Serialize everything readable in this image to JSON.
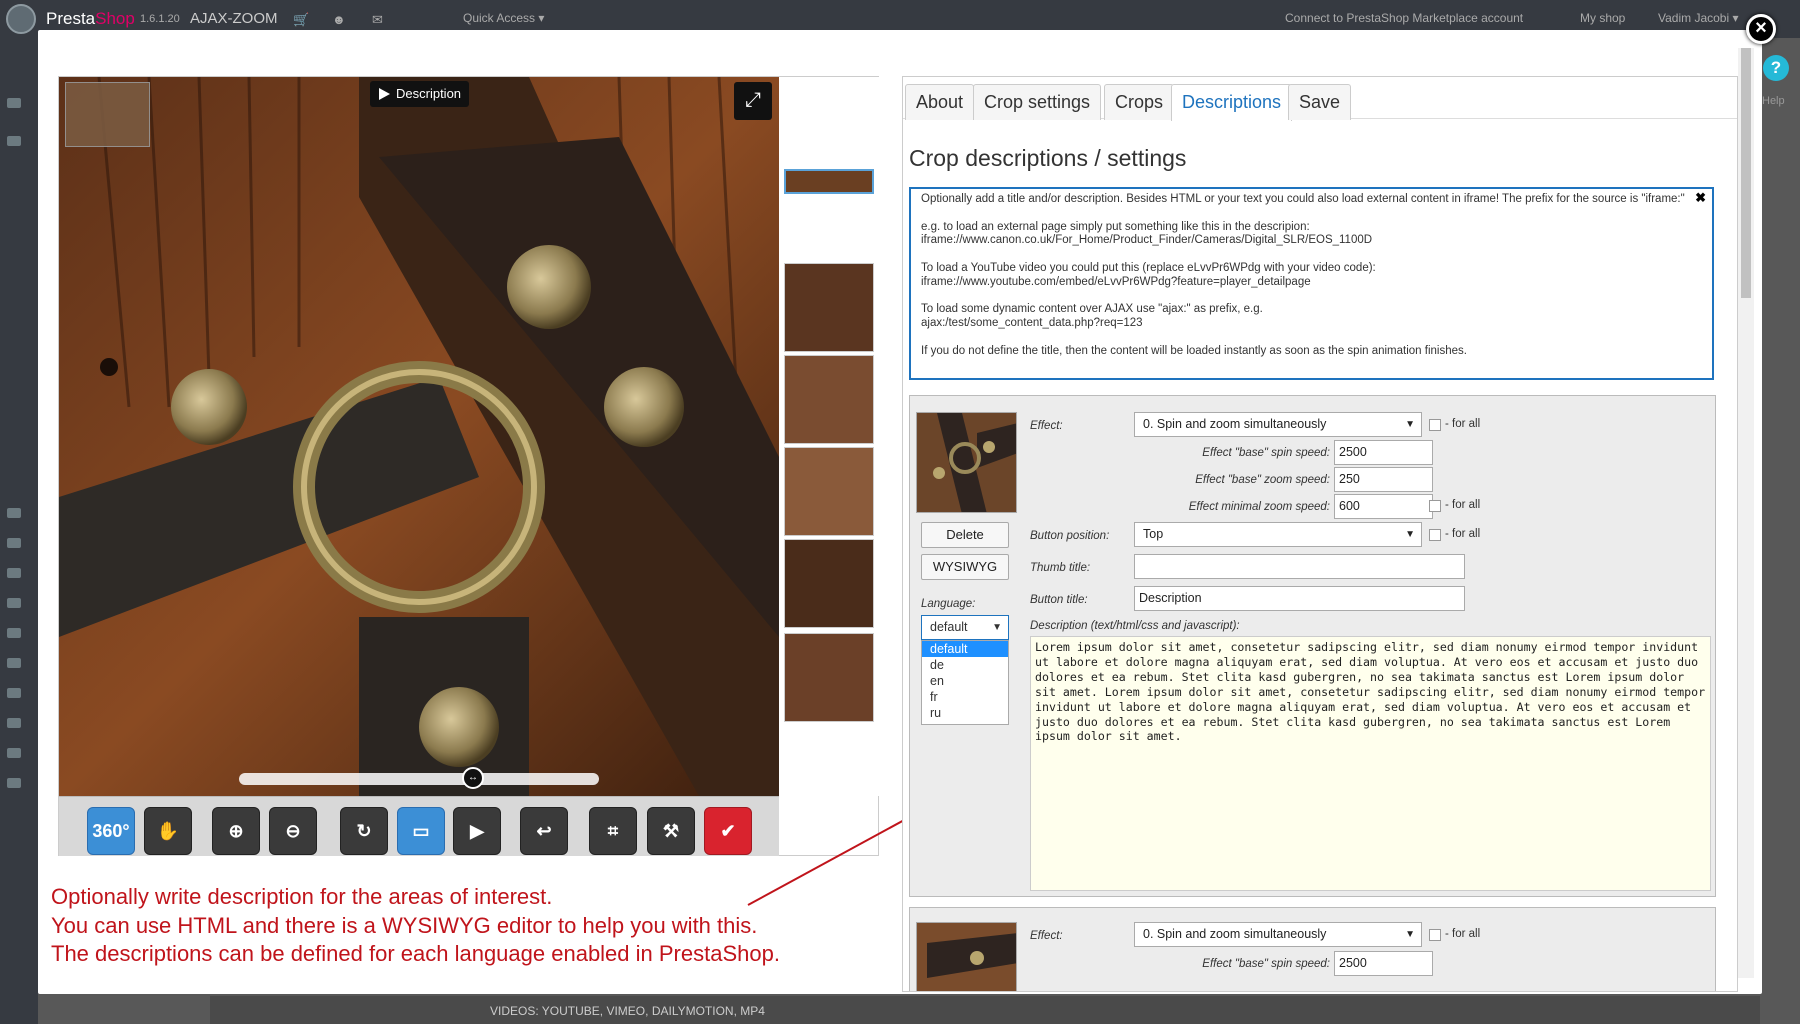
{
  "topbar": {
    "brand_a": "Presta",
    "brand_b": "Shop",
    "version": "1.6.1.20",
    "module": "AJAX-ZOOM",
    "quick_access": "Quick Access ▾",
    "marketplace": "Connect to PrestaShop Marketplace account",
    "my_shop": "My shop",
    "user": "Vadim Jacobi ▾"
  },
  "help": {
    "label": "Help",
    "glyph": "?"
  },
  "bottom_strip": {
    "text": "VIDEOS: YOUTUBE, VIMEO, DAILYMOTION, MP4"
  },
  "viewer": {
    "description_button": "Description",
    "fullscreen_icon": "⤢",
    "slider_knob": "↔",
    "toolbar": [
      {
        "name": "spin-360-button",
        "label": "360°",
        "style": "blue"
      },
      {
        "name": "pan-hand-button",
        "label": "✋",
        "style": "dark"
      },
      {
        "name": "zoom-in-button",
        "label": "⊕",
        "style": "dark"
      },
      {
        "name": "zoom-out-button",
        "label": "⊖",
        "style": "dark"
      },
      {
        "name": "reset-button",
        "label": "↻",
        "style": "dark"
      },
      {
        "name": "fullscreen-monitor-button",
        "label": "▭",
        "style": "blue"
      },
      {
        "name": "play-button",
        "label": "▶",
        "style": "dark"
      },
      {
        "name": "undo-button",
        "label": "↩",
        "style": "dark"
      },
      {
        "name": "crop-button",
        "label": "⌗",
        "style": "dark"
      },
      {
        "name": "tools-button",
        "label": "⚒",
        "style": "dark"
      },
      {
        "name": "confirm-button",
        "label": "✔",
        "style": "red"
      }
    ]
  },
  "annotation": {
    "line1": "Optionally write description for the areas of interest.",
    "line2": "You can use HTML and there is a WYSIWYG editor to help you with this.",
    "line3": "The descriptions can be defined for each language enabled in PrestaShop."
  },
  "tabs": [
    "About",
    "Crop settings",
    "Crops",
    "Descriptions",
    "Save"
  ],
  "active_tab": "Descriptions",
  "heading": "Crop descriptions / settings",
  "info": {
    "p1": "Optionally add a title and/or description. Besides HTML or your text you could also load external content in iframe! The prefix for the source is \"iframe:\"",
    "p2": "e.g. to load an external page simply put something like this in the descripion:",
    "p2b": "iframe://www.canon.co.uk/For_Home/Product_Finder/Cameras/Digital_SLR/EOS_1100D",
    "p3": "To load a YouTube video you could put this (replace eLvvPr6WPdg with your video code):",
    "p3b": "iframe://www.youtube.com/embed/eLvvPr6WPdg?feature=player_detailpage",
    "p4": "To load some dynamic content over AJAX use \"ajax:\" as prefix, e.g.",
    "p4b": "ajax:/test/some_content_data.php?req=123",
    "p5": "If you do not define the title, then the content will be loaded instantly as soon as the spin animation finishes.",
    "close": "✖"
  },
  "crop1": {
    "effect_label": "Effect:",
    "effect_value": "0. Spin and zoom simultaneously",
    "for_all": "- for all",
    "base_spin_label": "Effect \"base\" spin speed:",
    "base_spin_value": "2500",
    "base_zoom_label": "Effect \"base\" zoom speed:",
    "base_zoom_value": "250",
    "min_zoom_label": "Effect minimal zoom speed:",
    "min_zoom_value": "600",
    "delete": "Delete",
    "wysiwyg": "WYSIWYG",
    "button_position_label": "Button position:",
    "button_position_value": "Top",
    "thumb_title_label": "Thumb title:",
    "thumb_title_value": "",
    "button_title_label": "Button title:",
    "button_title_value": "Description",
    "language_label": "Language:",
    "language_value": "default",
    "language_options": [
      "default",
      "de",
      "en",
      "fr",
      "ru"
    ],
    "description_label": "Description (text/html/css and javascript):",
    "description_value": "Lorem ipsum dolor sit amet, consetetur sadipscing elitr, sed diam nonumy eirmod tempor invidunt ut labore et dolore magna aliquyam erat, sed diam voluptua. At vero eos et accusam et justo duo dolores et ea rebum. Stet clita kasd gubergren, no sea takimata sanctus est Lorem ipsum dolor sit amet. Lorem ipsum dolor sit amet, consetetur sadipscing elitr, sed diam nonumy eirmod tempor invidunt ut labore et dolore magna aliquyam erat, sed diam voluptua. At vero eos et accusam et justo duo dolores et ea rebum. Stet clita kasd gubergren, no sea takimata sanctus est Lorem ipsum dolor sit amet."
  },
  "crop2": {
    "effect_label": "Effect:",
    "effect_value": "0. Spin and zoom simultaneously",
    "for_all": "- for all",
    "base_spin_label": "Effect \"base\" spin speed:",
    "base_spin_value": "2500"
  },
  "colors": {
    "accent": "#1e73be",
    "annotation_red": "#c0141b",
    "tab_active": "#1e73be",
    "dropdown_highlight": "#1e90ff",
    "description_bg": "#ffffed"
  }
}
